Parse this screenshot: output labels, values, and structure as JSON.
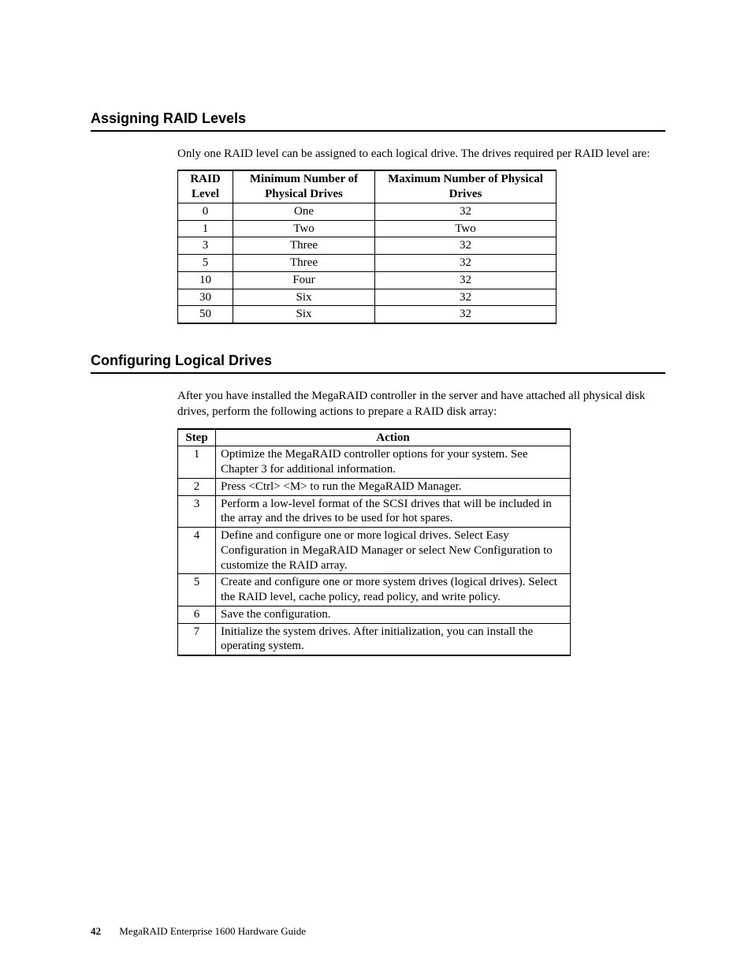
{
  "sections": {
    "raid": {
      "heading": "Assigning RAID Levels",
      "intro": "Only one RAID level can be assigned to each logical drive. The drives required per RAID level are:",
      "headers": {
        "col1_line1": "RAID",
        "col1_line2": "Level",
        "col2_line1": "Minimum Number of",
        "col2_line2": "Physical Drives",
        "col3_line1": "Maximum Number of Physical",
        "col3_line2": "Drives"
      },
      "rows": [
        {
          "level": "0",
          "min": "One",
          "max": "32"
        },
        {
          "level": "1",
          "min": "Two",
          "max": "Two"
        },
        {
          "level": "3",
          "min": "Three",
          "max": "32"
        },
        {
          "level": "5",
          "min": "Three",
          "max": "32"
        },
        {
          "level": "10",
          "min": "Four",
          "max": "32"
        },
        {
          "level": "30",
          "min": "Six",
          "max": "32"
        },
        {
          "level": "50",
          "min": "Six",
          "max": "32"
        }
      ]
    },
    "config": {
      "heading": "Configuring Logical Drives",
      "intro": "After you have installed the MegaRAID controller in the server and have attached all physical disk drives, perform the following actions to prepare a RAID disk array:",
      "headers": {
        "col1": "Step",
        "col2": "Action"
      },
      "steps": [
        {
          "num": "1",
          "action": "Optimize the MegaRAID controller options for your system. See Chapter 3 for additional information."
        },
        {
          "num": "2",
          "action": "Press <Ctrl> <M> to run the MegaRAID Manager."
        },
        {
          "num": "3",
          "action": "Perform a low-level format of the SCSI drives that will be included in the array and the drives to be used for hot spares."
        },
        {
          "num": "4",
          "action": "Define and configure one or more logical drives. Select Easy Configuration in MegaRAID Manager or select New Configuration to customize the RAID array."
        },
        {
          "num": "5",
          "action": "Create and configure one or more system drives (logical drives). Select the RAID level, cache policy, read policy, and write policy."
        },
        {
          "num": "6",
          "action": "Save the configuration."
        },
        {
          "num": "7",
          "action": "Initialize the system drives. After initialization, you can install the operating system."
        }
      ]
    }
  },
  "footer": {
    "page": "42",
    "title": "MegaRAID Enterprise 1600 Hardware Guide"
  }
}
